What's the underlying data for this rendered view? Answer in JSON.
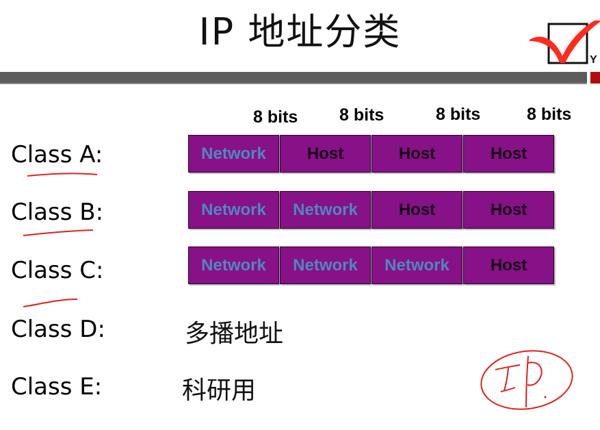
{
  "title": "IP 地址分类",
  "bits_labels": [
    "8 bits",
    "8 bits",
    "8 bits",
    "8 bits"
  ],
  "classes": [
    {
      "label": "Class A:",
      "segments": [
        {
          "text": "Network",
          "type": "network"
        },
        {
          "text": "Host",
          "type": "host"
        },
        {
          "text": "Host",
          "type": "host"
        },
        {
          "text": "Host",
          "type": "host"
        }
      ]
    },
    {
      "label": "Class B:",
      "segments": [
        {
          "text": "Network",
          "type": "network"
        },
        {
          "text": "Network",
          "type": "network"
        },
        {
          "text": "Host",
          "type": "host"
        },
        {
          "text": "Host",
          "type": "host"
        }
      ]
    },
    {
      "label": "Class C:",
      "segments": [
        {
          "text": "Network",
          "type": "network"
        },
        {
          "text": "Network",
          "type": "network"
        },
        {
          "text": "Network",
          "type": "network"
        },
        {
          "text": "Host",
          "type": "host"
        }
      ]
    },
    {
      "label": "Class D:",
      "description": "多播地址"
    },
    {
      "label": "Class E:",
      "description": "科研用"
    }
  ],
  "logo": {
    "icon": "checkbox-check-icon",
    "letter": "Y"
  },
  "annotation": {
    "text": "IP.",
    "color": "#e0201b"
  },
  "colors": {
    "cell_fill": "#871187",
    "network_text": "#4f86c6",
    "host_text": "#160016",
    "bar": "#5c5c5c",
    "bar_accent": "#b00d0d"
  }
}
